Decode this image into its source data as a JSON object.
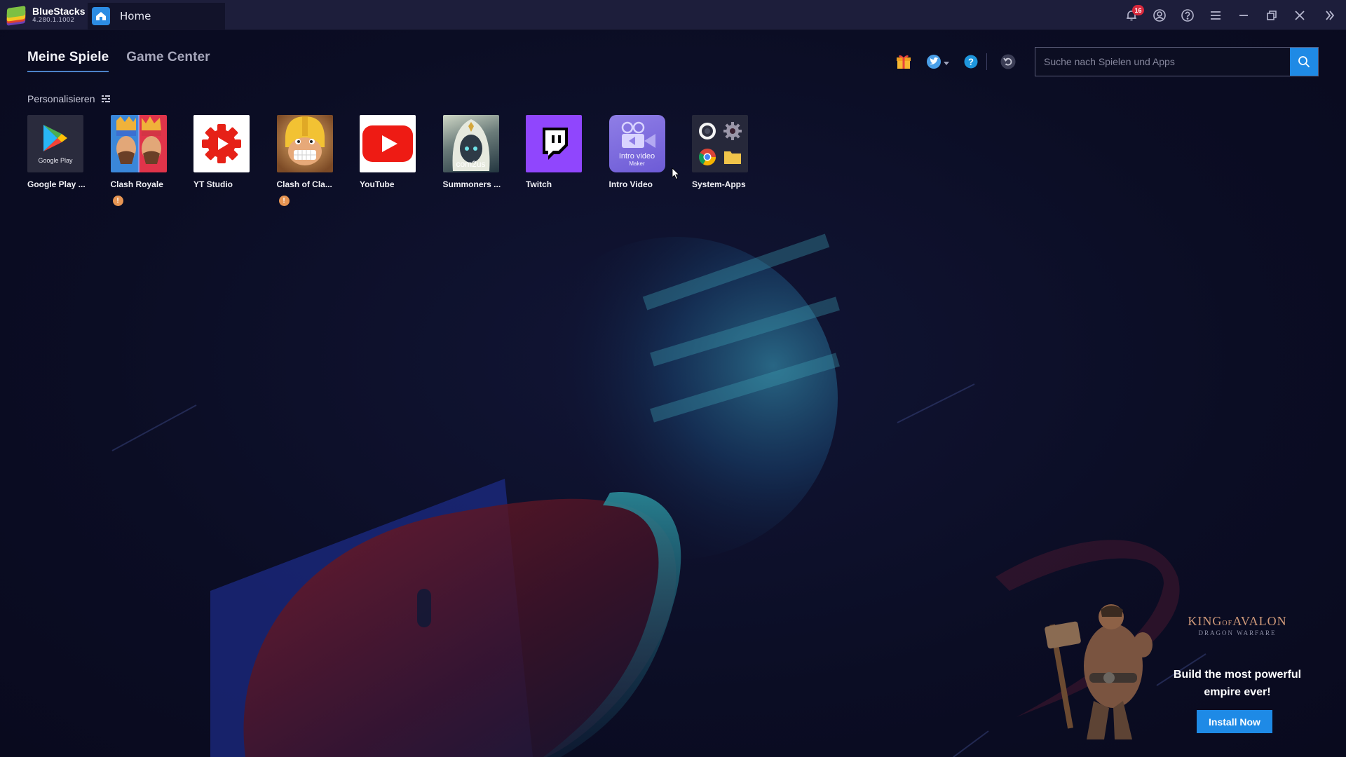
{
  "titlebar": {
    "app_name": "BlueStacks",
    "version": "4.280.1.1002",
    "home_tab": "Home",
    "notification_count": "16",
    "icons": [
      "bell-icon",
      "account-icon",
      "help-icon",
      "menu-icon",
      "minimize-icon",
      "restore-icon",
      "close-icon",
      "sidebar-toggle-icon"
    ]
  },
  "tabs": [
    {
      "label": "Meine Spiele",
      "active": true
    },
    {
      "label": "Game Center",
      "active": false
    }
  ],
  "personalize": {
    "label": "Personalisieren",
    "icon": "grid-icon"
  },
  "toolbar": {
    "icons": [
      "gift-icon",
      "twitter-icon",
      "help-icon",
      "refresh-icon"
    ],
    "search_placeholder": "Suche nach Spielen und Apps",
    "search_value": ""
  },
  "apps": [
    {
      "label": "Google Play ...",
      "icon": "google-play-icon",
      "icon_text": "Google Play",
      "warning": false
    },
    {
      "label": "Clash Royale",
      "icon": "clash-royale-icon",
      "warning": true
    },
    {
      "label": "YT Studio",
      "icon": "yt-studio-icon",
      "warning": false
    },
    {
      "label": "Clash of Cla...",
      "icon": "clash-of-clans-icon",
      "warning": true
    },
    {
      "label": "YouTube",
      "icon": "youtube-icon",
      "warning": false
    },
    {
      "label": "Summoners ...",
      "icon": "summoners-war-icon",
      "icon_text": "com2us",
      "warning": false
    },
    {
      "label": "Twitch",
      "icon": "twitch-icon",
      "warning": false
    },
    {
      "label": "Intro Video",
      "icon": "intro-video-icon",
      "icon_text_1": "Intro video",
      "icon_text_2": "Maker",
      "warning": false
    },
    {
      "label": "System-Apps",
      "icon": "system-apps-icon",
      "warning": false
    }
  ],
  "warning_glyph": "!",
  "ad": {
    "game_title_1": "KING",
    "game_title_2": "OF",
    "game_title_3": "AVALON",
    "game_subtitle": "DRAGON WARFARE",
    "headline": "Build the most powerful empire ever!",
    "button_label": "Install Now"
  },
  "colors": {
    "accent": "#1f8ae5",
    "titlebar_bg": "#1d1e3b",
    "page_bg": "#0d0f26",
    "badge_red": "#d8283c",
    "warning_orange": "#e79553",
    "tab_underline": "#4d83c9"
  }
}
